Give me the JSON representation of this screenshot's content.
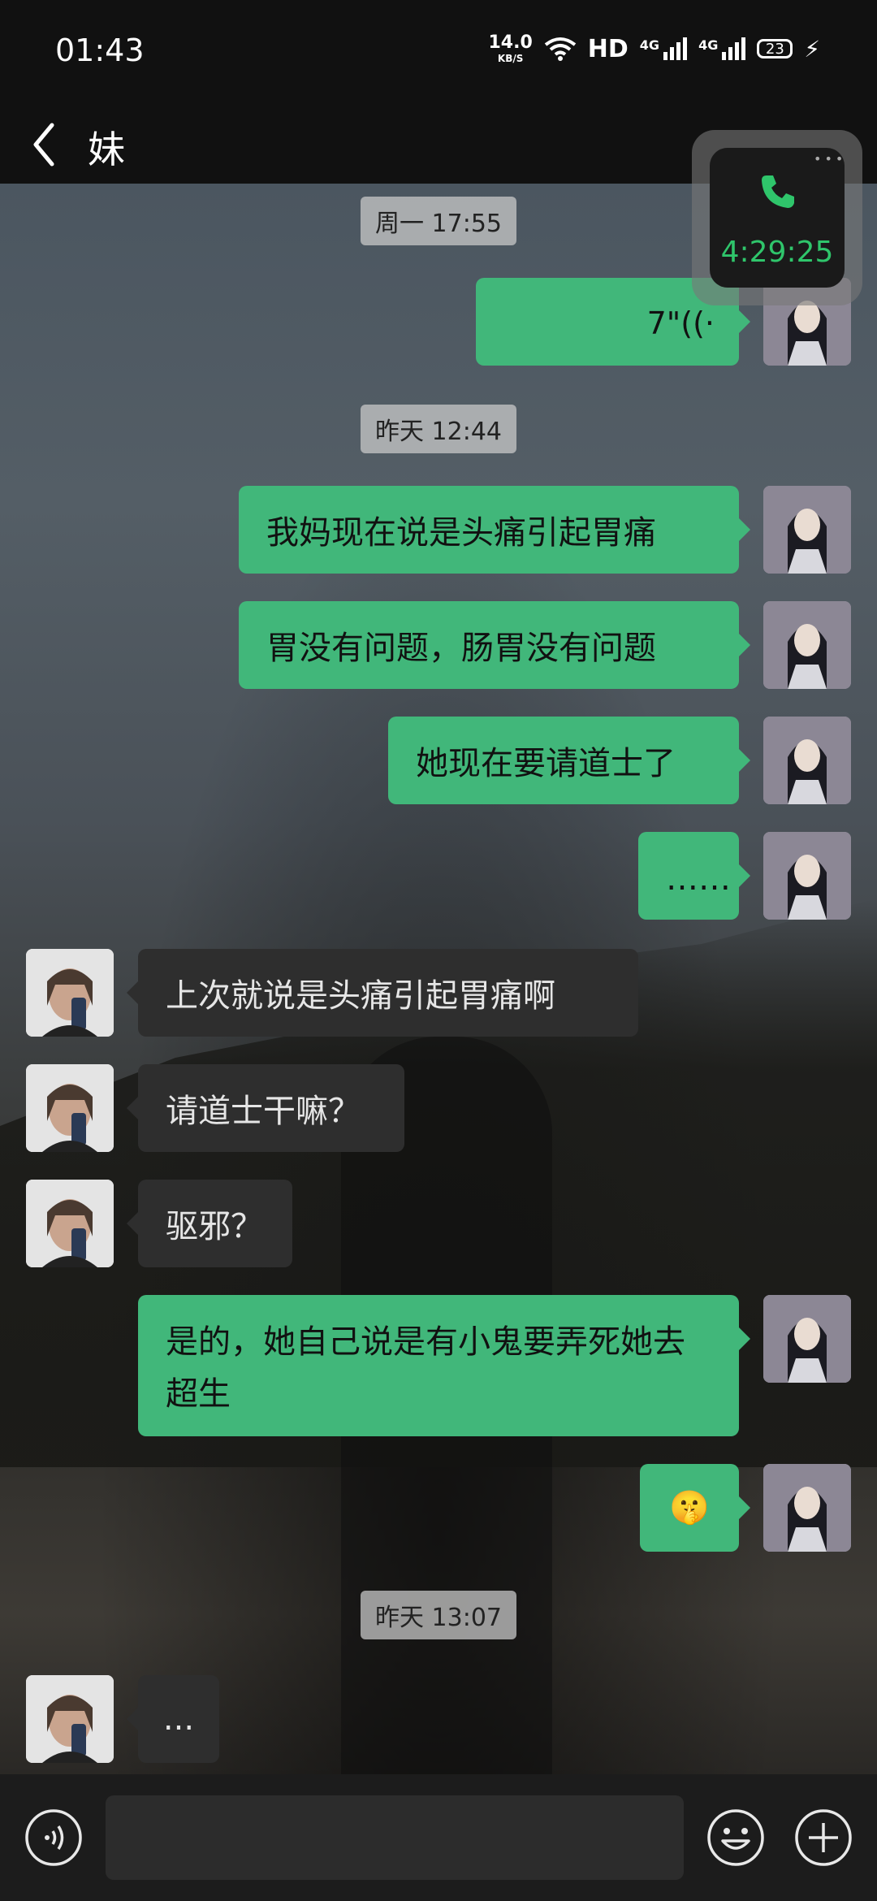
{
  "status": {
    "time": "01:43",
    "speed_value": "14.0",
    "speed_unit": "KB/S",
    "hd": "HD",
    "net1": "4G",
    "net2": "4G",
    "battery": "23"
  },
  "header": {
    "title": "妹"
  },
  "call_float": {
    "time": "4:29:25"
  },
  "timestamps": [
    "周一 17:55",
    "昨天 12:44",
    "昨天 13:07"
  ],
  "messages": {
    "voice": "7\"",
    "m1": "我妈现在说是头痛引起胃痛",
    "m2": "胃没有问题，肠胃没有问题",
    "m3": "她现在要请道士了",
    "m4": "……",
    "r1": "上次就说是头痛引起胃痛啊",
    "r2": "请道士干嘛？",
    "r3": "驱邪？",
    "m5": "是的，她自己说是有小鬼要弄死她去超生",
    "m6_emoji": "🤫",
    "r4": "..."
  },
  "colors": {
    "outgoing": "#41b77a",
    "incoming": "#2e2e2e",
    "call_green": "#2fc56b"
  },
  "icons": {
    "back": "chevron-left",
    "voice_mode": "voice-icon",
    "emoji": "emoji-icon",
    "plus": "plus-icon",
    "phone": "phone-icon"
  }
}
